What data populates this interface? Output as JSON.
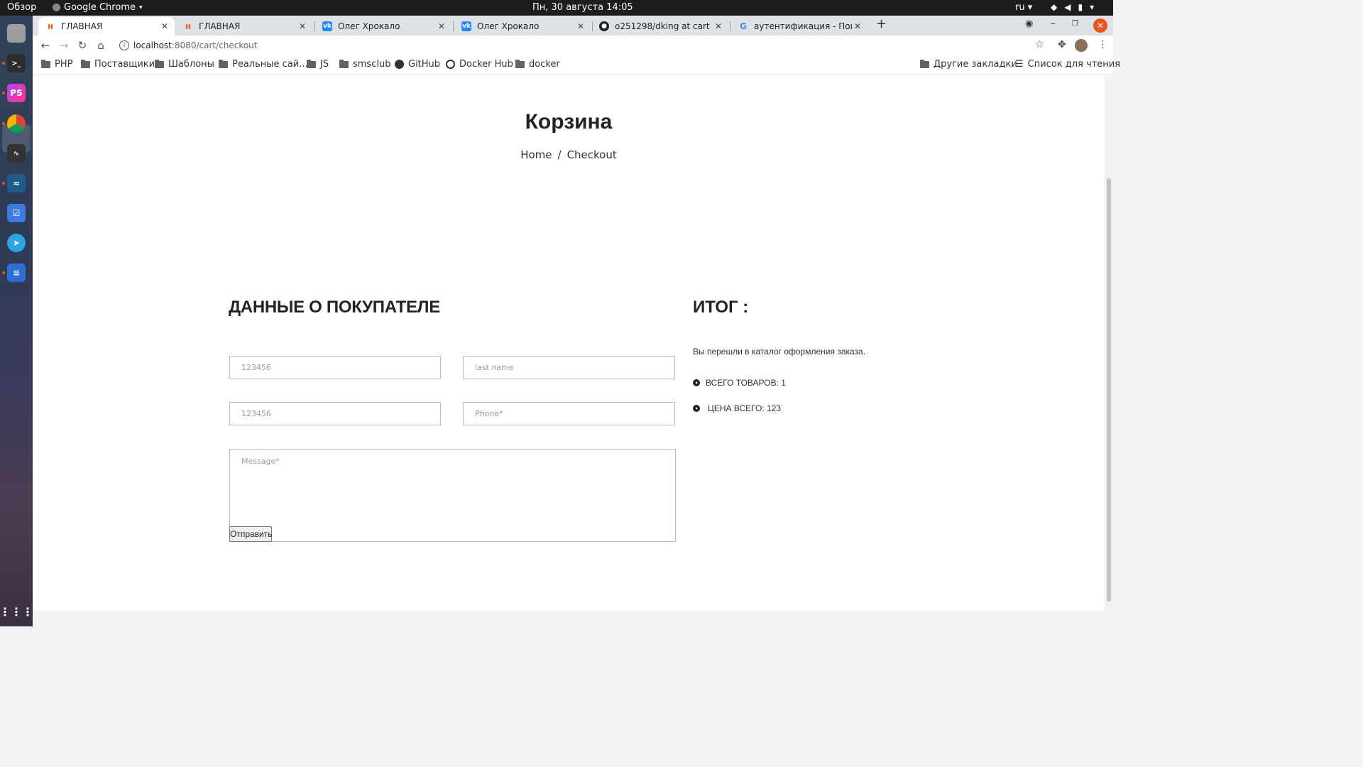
{
  "system": {
    "activities": "Обзор",
    "app_name": "Google Chrome",
    "clock": "Пн, 30 августа  14:05",
    "lang": "ru"
  },
  "tabs": [
    {
      "title": "ГЛАВНАЯ",
      "active": true,
      "favicon": "page-favicon"
    },
    {
      "title": "ГЛАВНАЯ",
      "active": false,
      "favicon": "page-favicon"
    },
    {
      "title": "Олег Хрокало",
      "active": false,
      "favicon": "vk-icon"
    },
    {
      "title": "Олег Хрокало",
      "active": false,
      "favicon": "vk-icon"
    },
    {
      "title": "o251298/dking at cart",
      "active": false,
      "favicon": "github-icon"
    },
    {
      "title": "аутентификация - Поиск",
      "active": false,
      "favicon": "google-icon"
    }
  ],
  "address": {
    "host": "localhost",
    "path": ":8080/cart/checkout"
  },
  "bookmarks": [
    {
      "label": "PHP",
      "icon": "folder-icon"
    },
    {
      "label": "Поставщики",
      "icon": "folder-icon"
    },
    {
      "label": "Шаблоны",
      "icon": "folder-icon"
    },
    {
      "label": "Реальные сай...",
      "icon": "folder-icon"
    },
    {
      "label": "JS",
      "icon": "folder-icon"
    },
    {
      "label": "smsclub",
      "icon": "folder-icon"
    },
    {
      "label": "GitHub",
      "icon": "github-icon"
    },
    {
      "label": "Docker Hub",
      "icon": "docker-icon"
    },
    {
      "label": "docker",
      "icon": "folder-icon"
    }
  ],
  "bookmarks_right": {
    "other": "Другие закладки",
    "reading_list": "Список для чтения"
  },
  "page": {
    "title": "Корзина",
    "breadcrumb_home": "Home",
    "breadcrumb_sep": "/",
    "breadcrumb_current": "Checkout",
    "buyer_heading": "ДАННЫЕ О ПОКУПАТЕЛЕ",
    "form": {
      "first_name_placeholder": "123456",
      "last_name_placeholder": "last name",
      "email_placeholder": "123456",
      "phone_placeholder": "Phone*",
      "message_placeholder": "Message*",
      "submit_label": "Отправить"
    },
    "summary": {
      "heading": "ИТОГ :",
      "text": "Вы перешли в каталог оформления заказа.",
      "total_items": "ВСЕГО ТОВАРОВ: 1",
      "total_price": "ЦЕНА ВСЕГО: 123"
    }
  },
  "colors": {
    "accent": "#e95420",
    "tabstrip": "#dee1e6"
  }
}
